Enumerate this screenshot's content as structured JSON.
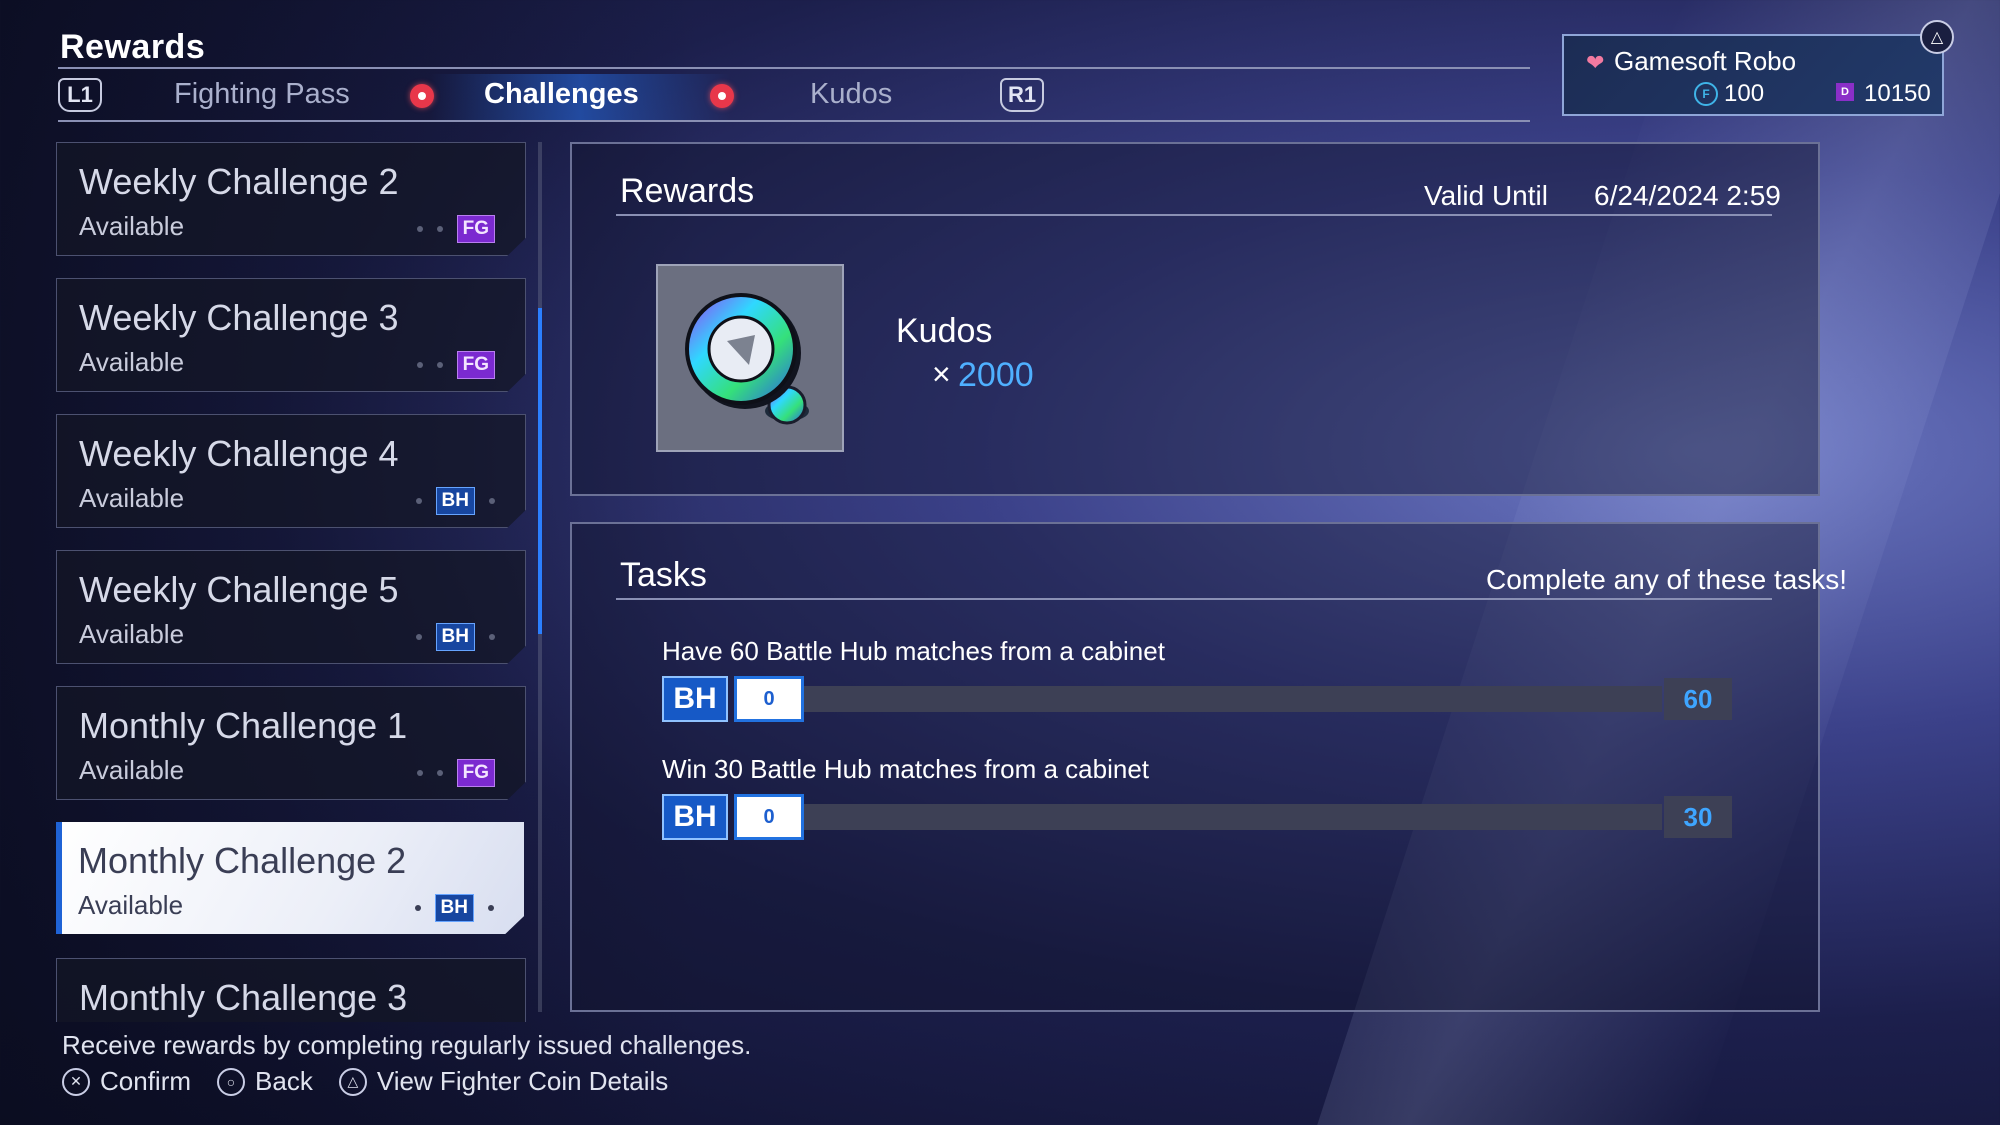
{
  "header": {
    "title": "Rewards",
    "shoulder_left": "L1",
    "shoulder_right": "R1",
    "tabs": [
      {
        "label": "Fighting Pass",
        "active": false,
        "alert": true
      },
      {
        "label": "Challenges",
        "active": true,
        "alert": true
      },
      {
        "label": "Kudos",
        "active": false,
        "alert": false
      }
    ]
  },
  "profile": {
    "name": "Gamesoft Robo",
    "fighter_coins": "100",
    "drive_tickets": "10150",
    "fc_glyph": "F",
    "dp_glyph": "D",
    "triangle_glyph": "△"
  },
  "challenges": [
    {
      "name": "Weekly Challenge 2",
      "status": "Available",
      "badge": "FG",
      "badge_type": "fg",
      "badge_slot": 3,
      "selected": false
    },
    {
      "name": "Weekly Challenge 3",
      "status": "Available",
      "badge": "FG",
      "badge_type": "fg",
      "badge_slot": 3,
      "selected": false
    },
    {
      "name": "Weekly Challenge 4",
      "status": "Available",
      "badge": "BH",
      "badge_type": "bh",
      "badge_slot": 2,
      "selected": false
    },
    {
      "name": "Weekly Challenge 5",
      "status": "Available",
      "badge": "BH",
      "badge_type": "bh",
      "badge_slot": 2,
      "selected": false
    },
    {
      "name": "Monthly Challenge 1",
      "status": "Available",
      "badge": "FG",
      "badge_type": "fg",
      "badge_slot": 3,
      "selected": false
    },
    {
      "name": "Monthly Challenge 2",
      "status": "Available",
      "badge": "BH",
      "badge_type": "bh",
      "badge_slot": 2,
      "selected": true
    },
    {
      "name": "Monthly Challenge 3",
      "status": "",
      "badge": "",
      "badge_type": "",
      "badge_slot": 0,
      "selected": false
    }
  ],
  "rewards_panel": {
    "title": "Rewards",
    "valid_label": "Valid Until",
    "valid_date": "6/24/2024 2:59",
    "item_name": "Kudos",
    "multiplier": "×",
    "quantity": "2000",
    "item_icon": "kudos-chip-icon"
  },
  "tasks_panel": {
    "title": "Tasks",
    "hint": "Complete any of these tasks!",
    "tasks": [
      {
        "label": "Have 60 Battle Hub matches from a cabinet",
        "badge": "BH",
        "current": "0",
        "max": "60",
        "progress": 0
      },
      {
        "label": "Win 30 Battle Hub matches from a cabinet",
        "badge": "BH",
        "current": "0",
        "max": "30",
        "progress": 0
      }
    ]
  },
  "footer": {
    "description": "Receive rewards by completing regularly issued challenges.",
    "controls": [
      {
        "glyph": "✕",
        "icon": "cross-button-icon",
        "label": "Confirm"
      },
      {
        "glyph": "○",
        "icon": "circle-button-icon",
        "label": "Back"
      },
      {
        "glyph": "△",
        "icon": "triangle-button-icon",
        "label": "View Fighter Coin Details"
      }
    ]
  },
  "colors": {
    "accent_blue": "#2b7fff",
    "fg_purple": "#7b2ad0",
    "bh_blue": "#1746a0",
    "alert_red": "#e8374a"
  }
}
